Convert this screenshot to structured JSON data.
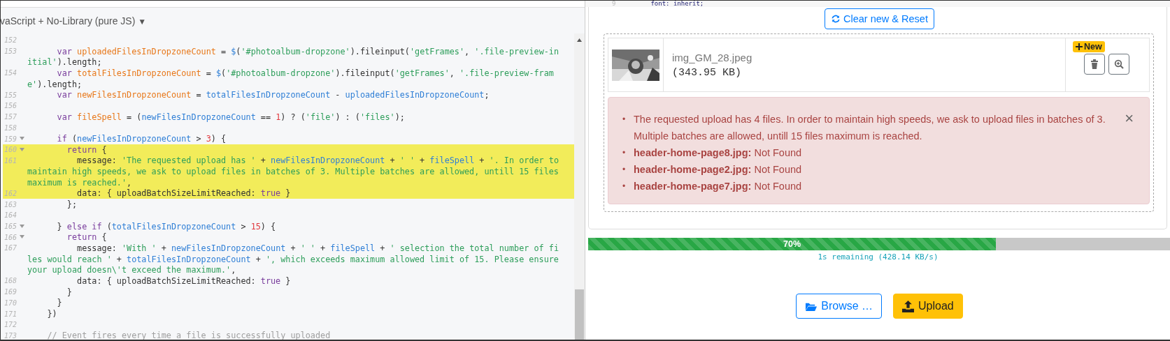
{
  "editor": {
    "language": "vaScript + No-Library (pure JS)",
    "caret": "▼",
    "lines": [
      {
        "number": "152",
        "foldable": false,
        "highlighted": false
      },
      {
        "number": "153",
        "foldable": false,
        "highlighted": false,
        "segments": [
          {
            "tokens": [
              {
                "kind": "keyword",
                "text": "      var "
              },
              {
                "kind": "def",
                "text": "uploadedFilesInDropzoneCount"
              },
              {
                "kind": "plain",
                "text": " = "
              },
              {
                "kind": "var",
                "text": "$"
              },
              {
                "kind": "plain",
                "text": "("
              },
              {
                "kind": "string",
                "text": "'#photoalbum-dropzone'"
              },
              {
                "kind": "plain",
                "text": ").fileinput("
              },
              {
                "kind": "string",
                "text": "'getFrames'"
              },
              {
                "kind": "plain",
                "text": ", "
              },
              {
                "kind": "string",
                "text": "'.file-preview-in"
              }
            ]
          },
          {
            "tokens": [
              {
                "kind": "string",
                "text": "itial'"
              },
              {
                "kind": "plain",
                "text": ").length;"
              }
            ]
          }
        ]
      },
      {
        "number": "154",
        "foldable": false,
        "highlighted": false,
        "segments": [
          {
            "tokens": [
              {
                "kind": "keyword",
                "text": "      var "
              },
              {
                "kind": "def",
                "text": "totalFilesInDropzoneCount"
              },
              {
                "kind": "plain",
                "text": " = "
              },
              {
                "kind": "var",
                "text": "$"
              },
              {
                "kind": "plain",
                "text": "("
              },
              {
                "kind": "string",
                "text": "'#photoalbum-dropzone'"
              },
              {
                "kind": "plain",
                "text": ").fileinput("
              },
              {
                "kind": "string",
                "text": "'getFrames'"
              },
              {
                "kind": "plain",
                "text": ", "
              },
              {
                "kind": "string",
                "text": "'.file-preview-fram"
              }
            ]
          },
          {
            "tokens": [
              {
                "kind": "string",
                "text": "e'"
              },
              {
                "kind": "plain",
                "text": ").length;"
              }
            ]
          }
        ]
      },
      {
        "number": "155",
        "foldable": false,
        "highlighted": false,
        "segments": [
          {
            "tokens": [
              {
                "kind": "keyword",
                "text": "      var "
              },
              {
                "kind": "def",
                "text": "newFilesInDropzoneCount"
              },
              {
                "kind": "plain",
                "text": " = "
              },
              {
                "kind": "var",
                "text": "totalFilesInDropzoneCount"
              },
              {
                "kind": "plain",
                "text": " - "
              },
              {
                "kind": "var",
                "text": "uploadedFilesInDropzoneCount"
              },
              {
                "kind": "plain",
                "text": ";"
              }
            ]
          }
        ]
      },
      {
        "number": "156",
        "foldable": false,
        "highlighted": false
      },
      {
        "number": "157",
        "foldable": false,
        "highlighted": false,
        "segments": [
          {
            "tokens": [
              {
                "kind": "keyword",
                "text": "      var "
              },
              {
                "kind": "def",
                "text": "fileSpell"
              },
              {
                "kind": "plain",
                "text": " = ("
              },
              {
                "kind": "var",
                "text": "newFilesInDropzoneCount"
              },
              {
                "kind": "plain",
                "text": " == "
              },
              {
                "kind": "number",
                "text": "1"
              },
              {
                "kind": "plain",
                "text": ") ? ("
              },
              {
                "kind": "string",
                "text": "'file'"
              },
              {
                "kind": "plain",
                "text": ") : ("
              },
              {
                "kind": "string",
                "text": "'files'"
              },
              {
                "kind": "plain",
                "text": ");"
              }
            ]
          }
        ]
      },
      {
        "number": "158",
        "foldable": false,
        "highlighted": false
      },
      {
        "number": "159",
        "foldable": true,
        "highlighted": false,
        "segments": [
          {
            "tokens": [
              {
                "kind": "keyword",
                "text": "      if"
              },
              {
                "kind": "plain",
                "text": " ("
              },
              {
                "kind": "var",
                "text": "newFilesInDropzoneCount"
              },
              {
                "kind": "plain",
                "text": " > "
              },
              {
                "kind": "number",
                "text": "3"
              },
              {
                "kind": "plain",
                "text": ") {"
              }
            ]
          }
        ]
      },
      {
        "number": "160",
        "foldable": true,
        "highlighted": true,
        "segments": [
          {
            "tokens": [
              {
                "kind": "keyword",
                "text": "        return"
              },
              {
                "kind": "plain",
                "text": " {"
              }
            ]
          }
        ]
      },
      {
        "number": "161",
        "foldable": false,
        "highlighted": true,
        "segments": [
          {
            "tokens": [
              {
                "kind": "plain",
                "text": "          message: "
              },
              {
                "kind": "string",
                "text": "'The requested upload has '"
              },
              {
                "kind": "plain",
                "text": " + "
              },
              {
                "kind": "var",
                "text": "newFilesInDropzoneCount"
              },
              {
                "kind": "plain",
                "text": " + "
              },
              {
                "kind": "string",
                "text": "' '"
              },
              {
                "kind": "plain",
                "text": " + "
              },
              {
                "kind": "var",
                "text": "fileSpell"
              },
              {
                "kind": "plain",
                "text": " + "
              },
              {
                "kind": "string",
                "text": "'. In order to"
              }
            ]
          },
          {
            "tokens": [
              {
                "kind": "string",
                "text": "maintain high speeds, we ask to upload files in batches of 3. Multiple batches are allowed, untill 15 files"
              }
            ]
          },
          {
            "tokens": [
              {
                "kind": "string",
                "text": "maximum is reached.'"
              },
              {
                "kind": "plain",
                "text": ","
              }
            ]
          }
        ]
      },
      {
        "number": "162",
        "foldable": false,
        "highlighted": true,
        "segments": [
          {
            "tokens": [
              {
                "kind": "plain",
                "text": "          data: { uploadBatchSizeLimitReached: "
              },
              {
                "kind": "atom",
                "text": "true"
              },
              {
                "kind": "plain",
                "text": " }"
              }
            ]
          }
        ]
      },
      {
        "number": "163",
        "foldable": false,
        "highlighted": false,
        "segments": [
          {
            "tokens": [
              {
                "kind": "plain",
                "text": "        };"
              }
            ]
          }
        ]
      },
      {
        "number": "164",
        "foldable": false,
        "highlighted": false
      },
      {
        "number": "165",
        "foldable": true,
        "highlighted": false,
        "segments": [
          {
            "tokens": [
              {
                "kind": "plain",
                "text": "      } "
              },
              {
                "kind": "keyword",
                "text": "else if"
              },
              {
                "kind": "plain",
                "text": " ("
              },
              {
                "kind": "var",
                "text": "totalFilesInDropzoneCount"
              },
              {
                "kind": "plain",
                "text": " > "
              },
              {
                "kind": "number",
                "text": "15"
              },
              {
                "kind": "plain",
                "text": ") {"
              }
            ]
          }
        ]
      },
      {
        "number": "166",
        "foldable": true,
        "highlighted": false,
        "segments": [
          {
            "tokens": [
              {
                "kind": "keyword",
                "text": "        return"
              },
              {
                "kind": "plain",
                "text": " {"
              }
            ]
          }
        ]
      },
      {
        "number": "167",
        "foldable": false,
        "highlighted": false,
        "segments": [
          {
            "tokens": [
              {
                "kind": "plain",
                "text": "          message: "
              },
              {
                "kind": "string",
                "text": "'With '"
              },
              {
                "kind": "plain",
                "text": " + "
              },
              {
                "kind": "var",
                "text": "newFilesInDropzoneCount"
              },
              {
                "kind": "plain",
                "text": " + "
              },
              {
                "kind": "string",
                "text": "' '"
              },
              {
                "kind": "plain",
                "text": " + "
              },
              {
                "kind": "var",
                "text": "fileSpell"
              },
              {
                "kind": "plain",
                "text": " + "
              },
              {
                "kind": "string",
                "text": "' selection the total number of fi"
              }
            ]
          },
          {
            "tokens": [
              {
                "kind": "string",
                "text": "les would reach '"
              },
              {
                "kind": "plain",
                "text": " + "
              },
              {
                "kind": "var",
                "text": "totalFilesInDropzoneCount"
              },
              {
                "kind": "plain",
                "text": " + "
              },
              {
                "kind": "string",
                "text": "', which exceeds maximum allowed limit of 15. Please ensure"
              }
            ]
          },
          {
            "tokens": [
              {
                "kind": "string",
                "text": "your upload doesn\\'t exceed the maximum.'"
              },
              {
                "kind": "plain",
                "text": ","
              }
            ]
          }
        ]
      },
      {
        "number": "168",
        "foldable": false,
        "highlighted": false,
        "segments": [
          {
            "tokens": [
              {
                "kind": "plain",
                "text": "          data: { uploadBatchSizeLimitReached: "
              },
              {
                "kind": "atom",
                "text": "true"
              },
              {
                "kind": "plain",
                "text": " }"
              }
            ]
          }
        ]
      },
      {
        "number": "169",
        "foldable": false,
        "highlighted": false,
        "segments": [
          {
            "tokens": [
              {
                "kind": "plain",
                "text": "        }"
              }
            ]
          }
        ]
      },
      {
        "number": "170",
        "foldable": false,
        "highlighted": false,
        "segments": [
          {
            "tokens": [
              {
                "kind": "plain",
                "text": "      }"
              }
            ]
          }
        ]
      },
      {
        "number": "171",
        "foldable": false,
        "highlighted": false,
        "segments": [
          {
            "tokens": [
              {
                "kind": "plain",
                "text": "    })"
              }
            ]
          }
        ]
      },
      {
        "number": "172",
        "foldable": false,
        "highlighted": false
      },
      {
        "number": "173",
        "foldable": false,
        "highlighted": false,
        "segments": [
          {
            "tokens": [
              {
                "kind": "comment",
                "text": "    // Event fires every time a file is successfully uploaded"
              }
            ]
          }
        ]
      }
    ]
  },
  "preview": {
    "code_peek": {
      "line_number": "9",
      "code": "font: inherit;"
    },
    "reset_button": "Clear new & Reset",
    "file": {
      "kind": "picture",
      "name": "img_GM_28.jpeg",
      "size": "(343.95 KB)",
      "badge": "New"
    },
    "alert": {
      "close": "×",
      "bullet": "•",
      "items": [
        "The requested upload has 4 files. In order to maintain high speeds, we ask to upload files in batches of 3. Multiple batches are allowed, untill 15 files maximum is reached.",
        "**header-home-page8.jpg:** Not Found",
        "**header-home-page2.jpg:** Not Found",
        "**header-home-page7.jpg:** Not Found"
      ]
    },
    "progress": {
      "level": 0.7,
      "label": "70%",
      "status": "1s remaining (428.14 KB/s)"
    },
    "buttons": [
      {
        "kind": "outline",
        "label": "Browse …"
      },
      {
        "kind": "warning",
        "label": "Upload"
      }
    ]
  }
}
